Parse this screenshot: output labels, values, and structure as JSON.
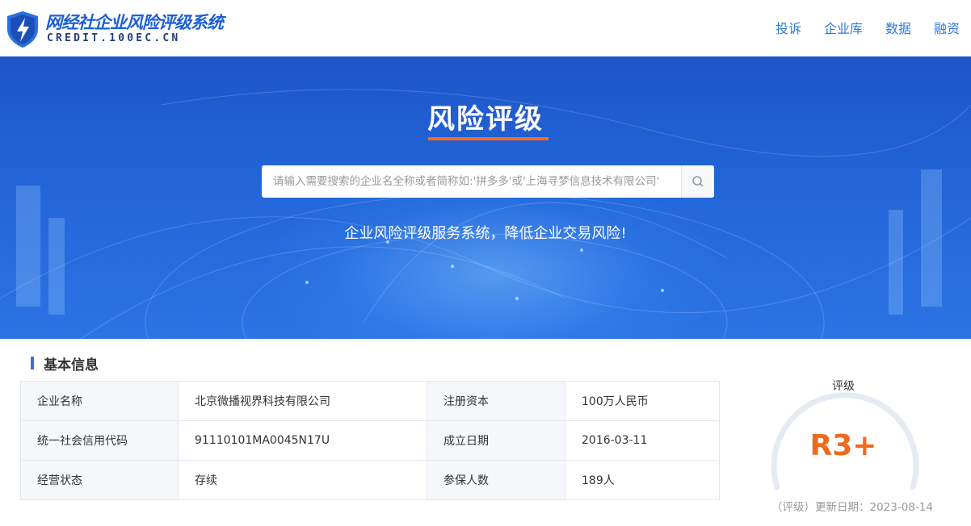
{
  "header": {
    "logo_title": "网经社企业风险评级系统",
    "logo_sub": "CREDIT.100EC.CN",
    "nav": [
      "投诉",
      "企业库",
      "数据",
      "融资"
    ]
  },
  "banner": {
    "title": "风险评级",
    "search_placeholder": "请输入需要搜索的企业名全称或者简称如:'拼多多'或'上海寻梦信息技术有限公司'",
    "slogan": "企业风险评级服务系统，降低企业交易风险!"
  },
  "basic_info": {
    "heading": "基本信息",
    "rows": [
      {
        "label1": "企业名称",
        "value1": "北京微播视界科技有限公司",
        "label2": "注册资本",
        "value2": "100万人民币"
      },
      {
        "label1": "统一社会信用代码",
        "value1": "91110101MA0045N17U",
        "label2": "成立日期",
        "value2": "2016-03-11"
      },
      {
        "label1": "经营状态",
        "value1": "存续",
        "label2": "参保人数",
        "value2": "189人"
      }
    ]
  },
  "rating": {
    "label": "评级",
    "value": "R3+",
    "update_text": "（评级）更新日期：2023-08-14"
  },
  "colors": {
    "brand_blue": "#2f7ae0",
    "accent_orange": "#ff6a1a",
    "rating_orange": "#f06a1c"
  }
}
